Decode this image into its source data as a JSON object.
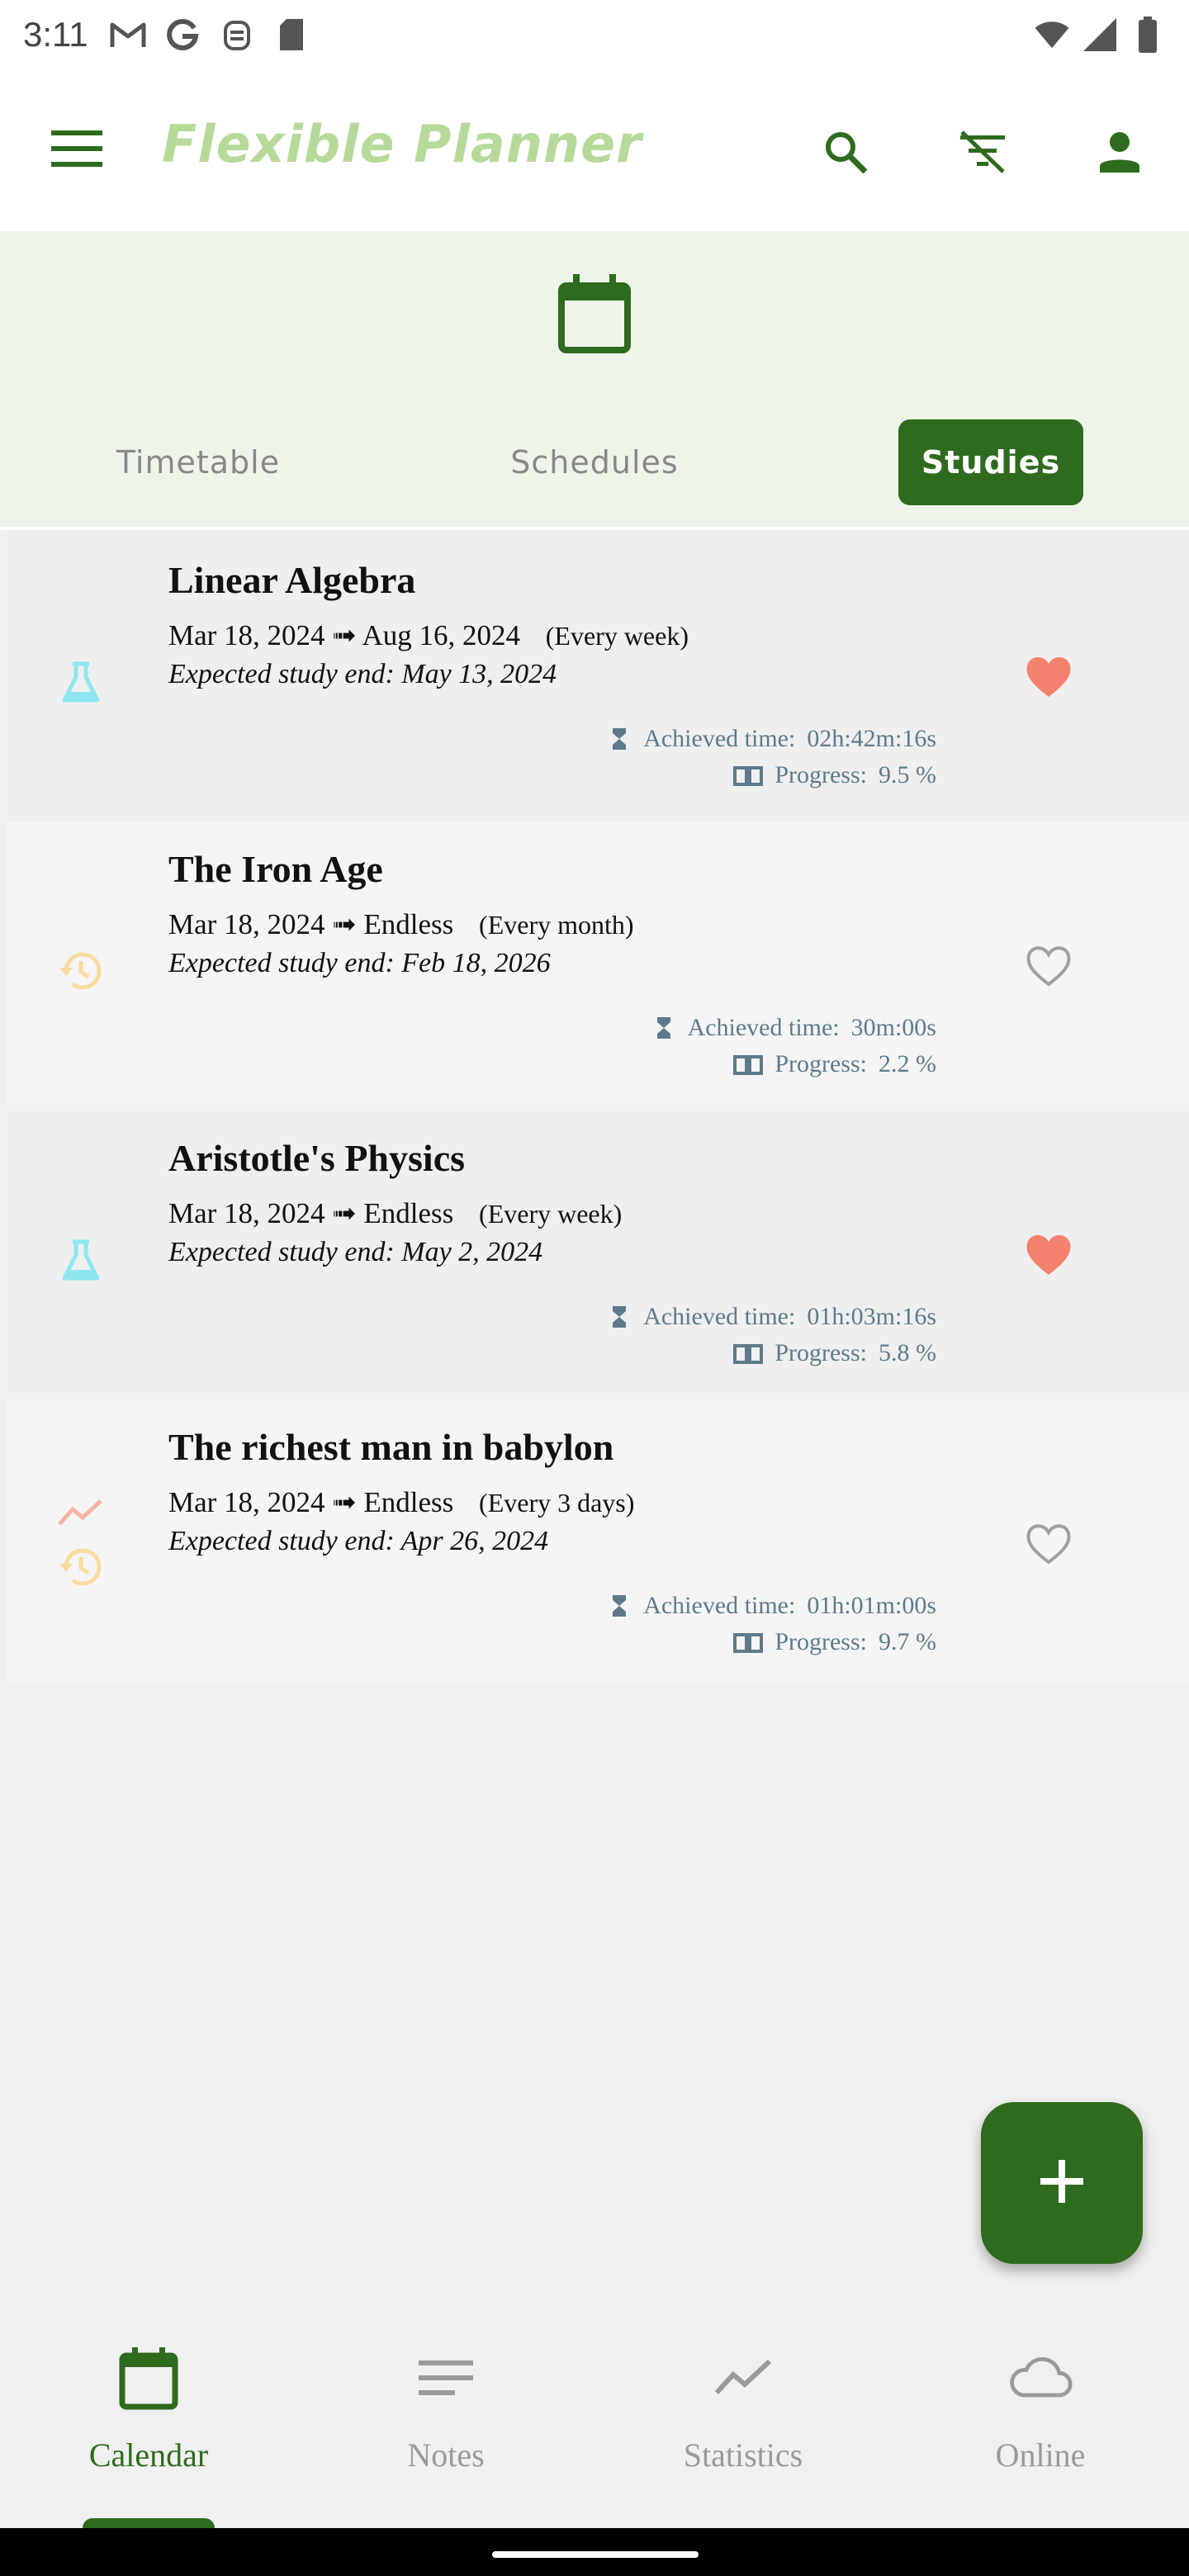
{
  "status_bar": {
    "time": "3:11"
  },
  "app_bar": {
    "title": "Flexible Planner"
  },
  "tabs": [
    {
      "label": "Timetable",
      "active": false
    },
    {
      "label": "Schedules",
      "active": false
    },
    {
      "label": "Studies",
      "active": true
    }
  ],
  "studies": [
    {
      "name": "Linear Algebra",
      "start": "Mar 18, 2024",
      "arrow": "➟",
      "end": "Aug 16, 2024",
      "repeat": "(Every  week)",
      "expected": "Expected study end: May 13, 2024",
      "achieved_label": "Achieved time:",
      "achieved_value": "02h:42m:16s",
      "progress_label": "Progress:",
      "progress_value": "9.5 %",
      "favorite": true,
      "type_icons": [
        "flask-icon"
      ]
    },
    {
      "name": "The Iron Age",
      "start": "Mar 18, 2024",
      "arrow": "➟",
      "end": "Endless",
      "repeat": "(Every  month)",
      "expected": "Expected study end: Feb 18, 2026",
      "achieved_label": "Achieved time:",
      "achieved_value": "30m:00s",
      "progress_label": "Progress:",
      "progress_value": "2.2 %",
      "favorite": false,
      "type_icons": [
        "history-icon"
      ]
    },
    {
      "name": "Aristotle's Physics",
      "start": "Mar 18, 2024",
      "arrow": "➟",
      "end": "Endless",
      "repeat": "(Every  week)",
      "expected": "Expected study end: May 2, 2024",
      "achieved_label": "Achieved time:",
      "achieved_value": "01h:03m:16s",
      "progress_label": "Progress:",
      "progress_value": "5.8 %",
      "favorite": true,
      "type_icons": [
        "flask-icon"
      ]
    },
    {
      "name": "The richest man in babylon",
      "start": "Mar 18, 2024",
      "arrow": "➟",
      "end": "Endless",
      "repeat": "(Every 3 days)",
      "expected": "Expected study end: Apr 26, 2024",
      "achieved_label": "Achieved time:",
      "achieved_value": "01h:01m:00s",
      "progress_label": "Progress:",
      "progress_value": "9.7 %",
      "favorite": false,
      "type_icons": [
        "trending-icon",
        "history-icon"
      ]
    }
  ],
  "fab": {
    "icon": "plus-icon"
  },
  "bottom_nav": [
    {
      "label": "Calendar",
      "icon": "calendar-icon",
      "active": true
    },
    {
      "label": "Notes",
      "icon": "notes-icon",
      "active": false
    },
    {
      "label": "Statistics",
      "icon": "statistics-icon",
      "active": false
    },
    {
      "label": "Online",
      "icon": "cloud-icon",
      "active": false
    }
  ],
  "colors": {
    "primary": "#2f6b1e",
    "title_accent": "#b7d99a",
    "heart_filled": "#f4806e",
    "flask": "#8ee6f0",
    "history": "#f7dba0",
    "trending": "#f5b4a4",
    "meta_text": "#5e7a8a"
  }
}
